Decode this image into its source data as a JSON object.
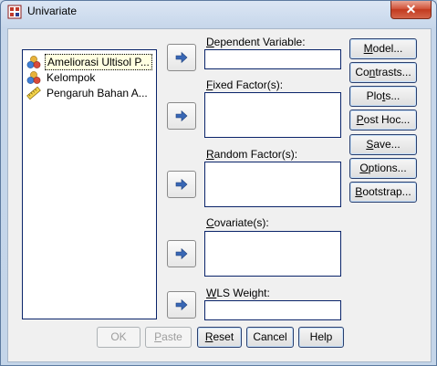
{
  "window": {
    "title": "Univariate",
    "close_glyph": "✕"
  },
  "variables": [
    {
      "label": "Ameliorasi Ultisol P...",
      "icon": "nominal-icon",
      "selected": true
    },
    {
      "label": "Kelompok",
      "icon": "nominal-icon",
      "selected": false
    },
    {
      "label": "Pengaruh Bahan A...",
      "icon": "scale-ruler-icon",
      "selected": false
    }
  ],
  "fields": {
    "dependent": {
      "pre": "",
      "u": "D",
      "post": "ependent Variable:"
    },
    "fixed": {
      "pre": "",
      "u": "F",
      "post": "ixed Factor(s):"
    },
    "random": {
      "pre": "",
      "u": "R",
      "post": "andom Factor(s):"
    },
    "covariate": {
      "pre": "",
      "u": "C",
      "post": "ovariate(s):"
    },
    "wls": {
      "pre": "",
      "u": "W",
      "post": "LS Weight:"
    }
  },
  "right_buttons": {
    "model": {
      "pre": "",
      "u": "M",
      "post": "odel..."
    },
    "contrasts": {
      "pre": "Co",
      "u": "n",
      "post": "trasts..."
    },
    "plots": {
      "pre": "Plo",
      "u": "t",
      "post": "s..."
    },
    "posthoc": {
      "pre": "",
      "u": "P",
      "post": "ost Hoc..."
    },
    "save": {
      "pre": "",
      "u": "S",
      "post": "ave..."
    },
    "options": {
      "pre": "",
      "u": "O",
      "post": "ptions..."
    },
    "bootstrap": {
      "pre": "",
      "u": "B",
      "post": "ootstrap..."
    }
  },
  "bottom_buttons": {
    "ok": {
      "pre": "OK",
      "u": "",
      "post": "",
      "disabled": true
    },
    "paste": {
      "pre": "",
      "u": "P",
      "post": "aste",
      "disabled": true
    },
    "reset": {
      "pre": "",
      "u": "R",
      "post": "eset",
      "disabled": false
    },
    "cancel": {
      "pre": "Cancel",
      "u": "",
      "post": "",
      "disabled": false
    },
    "help": {
      "pre": "Help",
      "u": "",
      "post": "",
      "disabled": false
    }
  },
  "colors": {
    "arrow": "#3867b5",
    "selection_bg": "#ffffe1",
    "close": "#c23a1f"
  }
}
